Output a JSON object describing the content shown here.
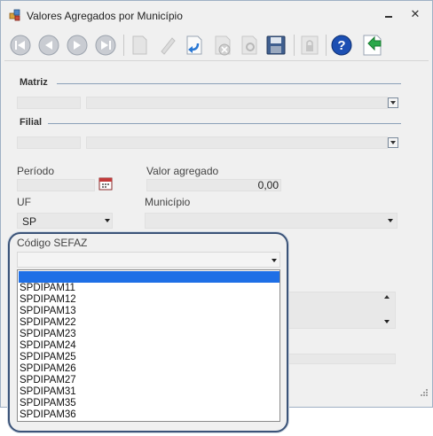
{
  "window": {
    "title": "Valores Agregados por Município",
    "close_glyph": "✕"
  },
  "toolbar": {
    "buttons": [
      "first-record-icon",
      "previous-record-icon",
      "next-record-icon",
      "last-record-icon",
      "new-record-icon",
      "edit-record-icon",
      "undo-icon",
      "cancel-icon",
      "search-icon",
      "save-icon",
      "lock-icon",
      "help-icon",
      "exit-icon"
    ]
  },
  "matriz": {
    "group_label": "Matriz",
    "code": "",
    "name": ""
  },
  "filial": {
    "group_label": "Filial",
    "code": "",
    "name": ""
  },
  "periodo": {
    "label": "Período",
    "value": ""
  },
  "valor_agregado": {
    "label": "Valor agregado",
    "value": "0,00"
  },
  "uf": {
    "label": "UF",
    "value": "SP"
  },
  "municipio": {
    "label": "Município",
    "value": ""
  },
  "codigo_sefaz": {
    "label": "Código SEFAZ",
    "value": "",
    "options": [
      "",
      "SPDIPAM11",
      "SPDIPAM12",
      "SPDIPAM13",
      "SPDIPAM22",
      "SPDIPAM23",
      "SPDIPAM24",
      "SPDIPAM25",
      "SPDIPAM26",
      "SPDIPAM27",
      "SPDIPAM31",
      "SPDIPAM35",
      "SPDIPAM36"
    ]
  },
  "colors": {
    "selection": "#1e6fe6",
    "callout_border": "#3b5378",
    "group_line": "#8aa0b8"
  }
}
